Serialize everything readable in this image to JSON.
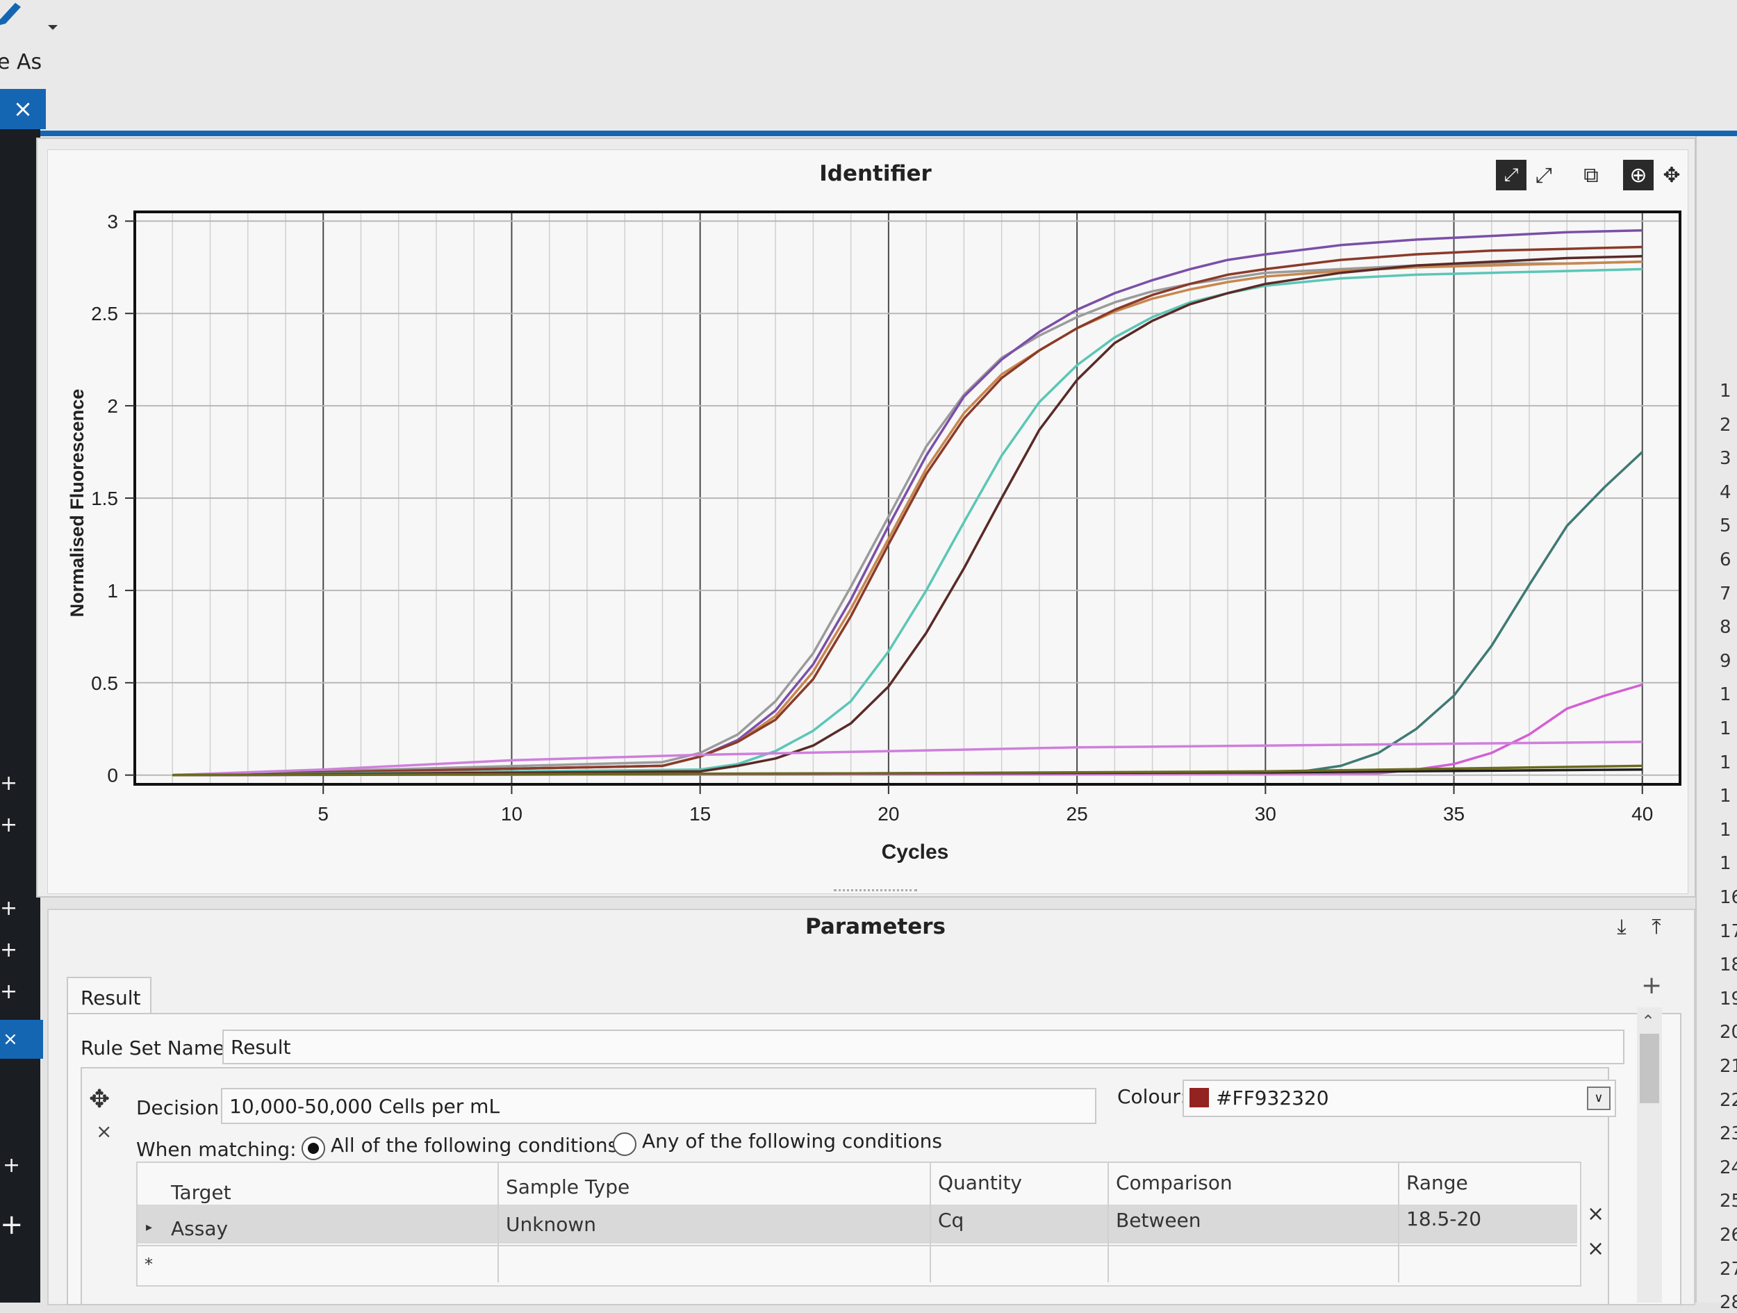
{
  "toolbar": {
    "save_as_fragment": "e As"
  },
  "tab": {
    "close_label": "×"
  },
  "chart_panel": {
    "title": "Identifier"
  },
  "chart_data": {
    "type": "line",
    "xlabel": "Cycles",
    "ylabel": "Normalised Fluorescence",
    "xlim": [
      0,
      41
    ],
    "ylim": [
      -0.05,
      3.05
    ],
    "xticks": [
      5,
      10,
      15,
      20,
      25,
      30,
      35,
      40
    ],
    "yticks": [
      0,
      0.5,
      1,
      1.5,
      2,
      2.5,
      3
    ],
    "grid": true,
    "series": [
      {
        "color": "#9b9b9b",
        "x": [
          1,
          14,
          15,
          16,
          17,
          18,
          19,
          20,
          21,
          22,
          23,
          24,
          25,
          26,
          27,
          28,
          29,
          30,
          32,
          34,
          36,
          38,
          40
        ],
        "y": [
          0,
          0.07,
          0.12,
          0.22,
          0.4,
          0.66,
          1.02,
          1.4,
          1.78,
          2.06,
          2.26,
          2.38,
          2.48,
          2.56,
          2.62,
          2.66,
          2.69,
          2.72,
          2.74,
          2.76,
          2.77,
          2.77,
          2.78
        ]
      },
      {
        "color": "#7b4fa8",
        "x": [
          1,
          14,
          15,
          16,
          17,
          18,
          19,
          20,
          21,
          22,
          23,
          24,
          25,
          26,
          27,
          28,
          29,
          30,
          32,
          34,
          36,
          38,
          40
        ],
        "y": [
          0,
          0.05,
          0.1,
          0.19,
          0.35,
          0.6,
          0.95,
          1.35,
          1.73,
          2.05,
          2.25,
          2.4,
          2.52,
          2.61,
          2.68,
          2.74,
          2.79,
          2.82,
          2.87,
          2.9,
          2.92,
          2.94,
          2.95
        ]
      },
      {
        "color": "#c8874e",
        "x": [
          1,
          14,
          15,
          16,
          17,
          18,
          19,
          20,
          21,
          22,
          23,
          24,
          25,
          26,
          27,
          28,
          29,
          30,
          32,
          34,
          36,
          38,
          40
        ],
        "y": [
          0,
          0.05,
          0.1,
          0.18,
          0.32,
          0.56,
          0.9,
          1.28,
          1.66,
          1.96,
          2.17,
          2.3,
          2.42,
          2.51,
          2.58,
          2.63,
          2.67,
          2.7,
          2.73,
          2.75,
          2.76,
          2.77,
          2.78
        ]
      },
      {
        "color": "#8b3a2a",
        "x": [
          1,
          14,
          15,
          16,
          17,
          18,
          19,
          20,
          21,
          22,
          23,
          24,
          25,
          26,
          27,
          28,
          29,
          30,
          32,
          34,
          36,
          38,
          40
        ],
        "y": [
          0,
          0.05,
          0.1,
          0.18,
          0.3,
          0.52,
          0.86,
          1.25,
          1.63,
          1.93,
          2.15,
          2.3,
          2.42,
          2.52,
          2.6,
          2.66,
          2.71,
          2.74,
          2.79,
          2.82,
          2.84,
          2.85,
          2.86
        ]
      },
      {
        "color": "#5cc6b6",
        "x": [
          1,
          15,
          16,
          17,
          18,
          19,
          20,
          21,
          22,
          23,
          24,
          25,
          26,
          27,
          28,
          29,
          30,
          32,
          34,
          36,
          38,
          40
        ],
        "y": [
          0,
          0.03,
          0.06,
          0.13,
          0.24,
          0.4,
          0.67,
          1.0,
          1.37,
          1.73,
          2.02,
          2.22,
          2.37,
          2.48,
          2.56,
          2.61,
          2.65,
          2.69,
          2.71,
          2.72,
          2.73,
          2.74
        ]
      },
      {
        "color": "#5a2a26",
        "x": [
          1,
          15,
          16,
          17,
          18,
          19,
          20,
          21,
          22,
          23,
          24,
          25,
          26,
          27,
          28,
          29,
          30,
          32,
          34,
          36,
          38,
          40
        ],
        "y": [
          0,
          0.02,
          0.05,
          0.09,
          0.16,
          0.28,
          0.48,
          0.77,
          1.12,
          1.5,
          1.87,
          2.14,
          2.34,
          2.46,
          2.55,
          2.61,
          2.66,
          2.72,
          2.76,
          2.78,
          2.8,
          2.81
        ]
      },
      {
        "color": "#3f7a74",
        "x": [
          1,
          30,
          31,
          32,
          33,
          34,
          35,
          36,
          37,
          38,
          39,
          40
        ],
        "y": [
          0,
          0.01,
          0.02,
          0.05,
          0.12,
          0.25,
          0.43,
          0.7,
          1.03,
          1.35,
          1.56,
          1.75
        ]
      },
      {
        "color": "#d45fd4",
        "x": [
          1,
          33,
          34,
          35,
          36,
          37,
          38,
          39,
          40
        ],
        "y": [
          0,
          0.01,
          0.03,
          0.06,
          0.12,
          0.22,
          0.36,
          0.43,
          0.49
        ]
      },
      {
        "color": "#cf7fdc",
        "x": [
          1,
          5,
          10,
          15,
          20,
          25,
          30,
          35,
          40
        ],
        "y": [
          0,
          0.03,
          0.08,
          0.11,
          0.13,
          0.15,
          0.16,
          0.17,
          0.18
        ]
      },
      {
        "color": "#1e1e1e",
        "x": [
          1,
          20,
          30,
          40
        ],
        "y": [
          0,
          0.01,
          0.015,
          0.03
        ]
      },
      {
        "color": "#6b6a1f",
        "x": [
          1,
          20,
          30,
          40
        ],
        "y": [
          0,
          0.01,
          0.02,
          0.05
        ]
      }
    ]
  },
  "params_panel": {
    "title": "Parameters",
    "tab_result": "Result",
    "add_symbol": "+",
    "rule_set_label": "Rule Set Name:",
    "rule_set_value": "Result",
    "decision_label": "Decision:",
    "decision_value": "10,000-50,000 Cells per mL",
    "colour_label": "Colour:",
    "colour_value": "#FF932320",
    "colour_swatch": "#932320",
    "when_matching_label": "When matching:",
    "option_all": "All of the following conditions",
    "option_any": "Any of the following conditions",
    "selected_option": "all",
    "columns": [
      "Target",
      "Sample Type",
      "Quantity",
      "Comparison",
      "Range"
    ],
    "rows": [
      {
        "target": "Assay",
        "sample_type": "Unknown",
        "quantity": "Cq",
        "comparison": "Between",
        "range": "18.5-20"
      }
    ],
    "row_delete": "×",
    "new_row_marker": "*"
  },
  "right_sheet": {
    "row_numbers": [
      "1",
      "2",
      "3",
      "4",
      "5",
      "6",
      "7",
      "8",
      "9",
      "1",
      "1",
      "1",
      "1",
      "1",
      "1",
      "16",
      "17",
      "18",
      "19",
      "20",
      "21",
      "22",
      "23",
      "24",
      "25",
      "26",
      "27",
      "28"
    ]
  }
}
